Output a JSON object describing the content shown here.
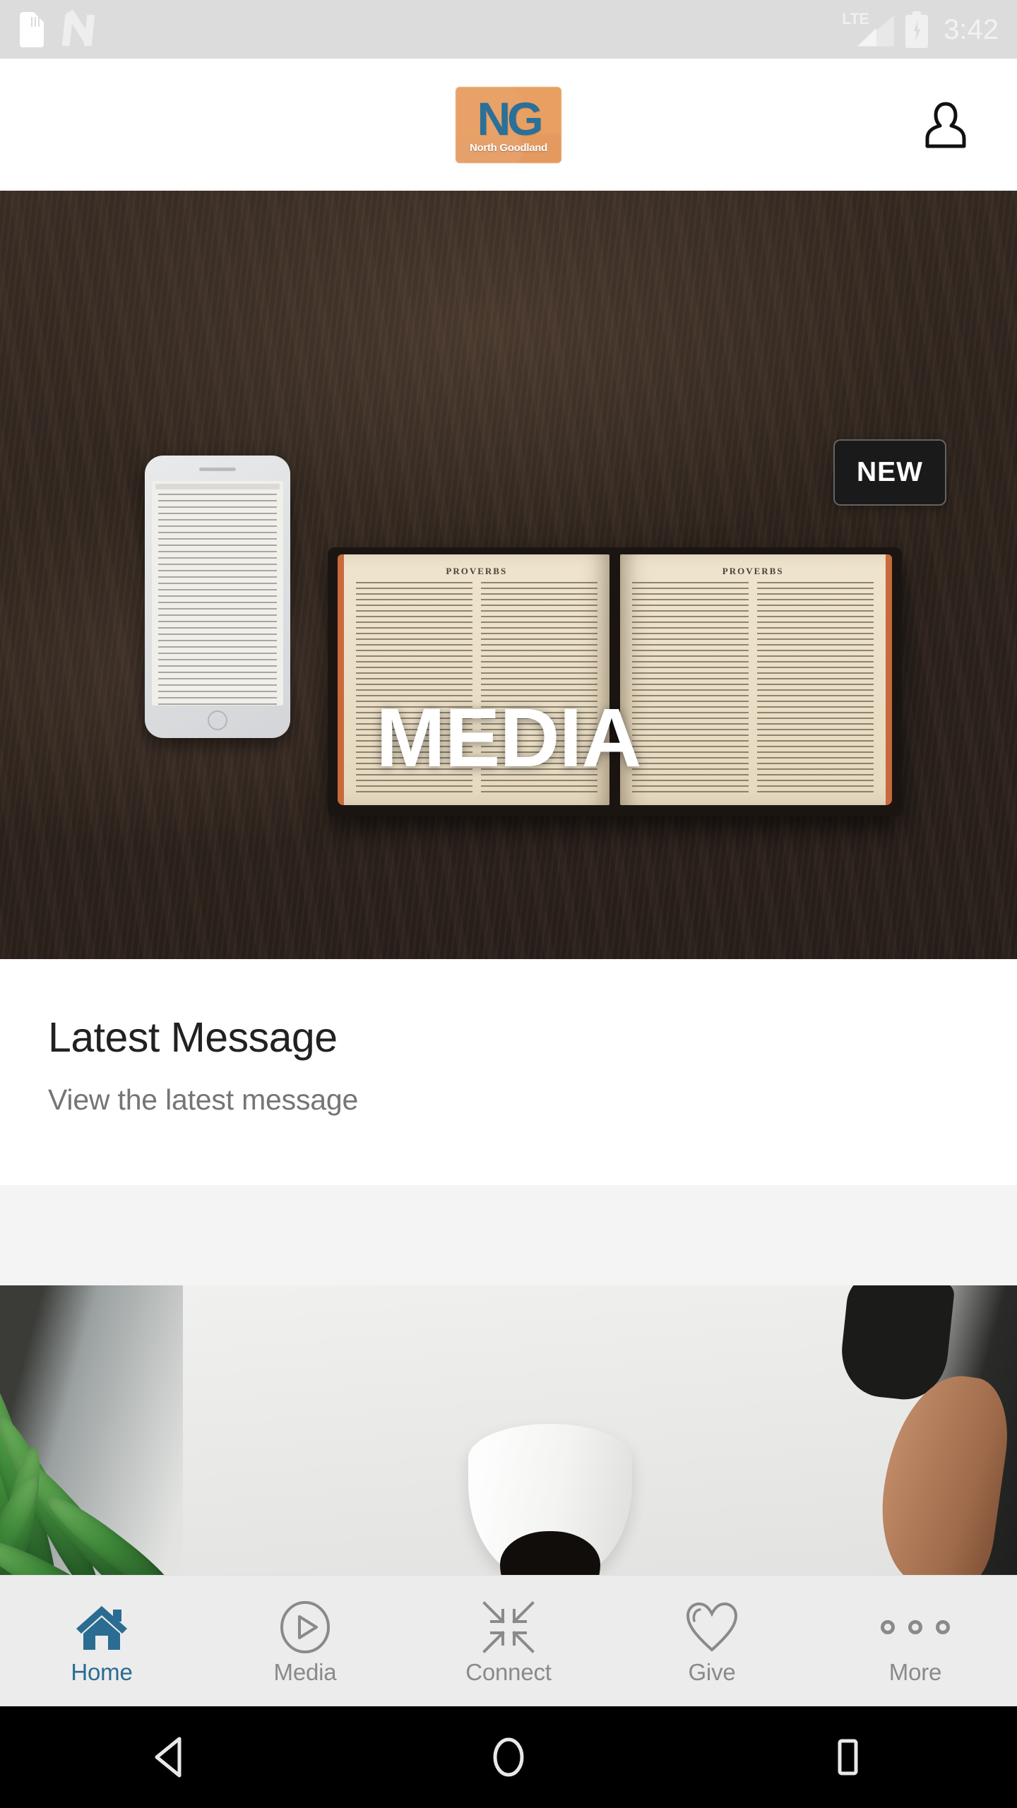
{
  "status_bar": {
    "icons": [
      "sim-card-icon",
      "nfc-icon"
    ],
    "network_label": "LTE",
    "signal_icon": "signal-bars-icon",
    "battery_icon": "battery-charging-icon",
    "time": "3:42"
  },
  "header": {
    "logo": {
      "initials": "NG",
      "name": "North Goodland",
      "bg_color": "#e5a066",
      "text_color": "#2a7099"
    },
    "profile_icon": "person-icon"
  },
  "hero": {
    "title": "MEDIA",
    "badge": "NEW",
    "image_alt": "open-bible-and-phone-on-wooden-table",
    "badge_bg": "#1a1a1a"
  },
  "latest_message": {
    "title": "Latest Message",
    "subtitle": "View the latest message"
  },
  "coffee_card": {
    "image_alt": "coffee-cup-plant-and-arm"
  },
  "bottom_nav": {
    "active_color": "#2a6c92",
    "inactive_color": "#8a8a8a",
    "items": [
      {
        "label": "Home",
        "icon": "home-icon",
        "active": true
      },
      {
        "label": "Media",
        "icon": "play-circle-icon",
        "active": false
      },
      {
        "label": "Connect",
        "icon": "connect-arrows-icon",
        "active": false
      },
      {
        "label": "Give",
        "icon": "heart-icon",
        "active": false
      },
      {
        "label": "More",
        "icon": "more-dots-icon",
        "active": false
      }
    ]
  },
  "android_nav": {
    "back": "back-triangle-icon",
    "home": "home-circle-icon",
    "recents": "recents-square-icon"
  }
}
